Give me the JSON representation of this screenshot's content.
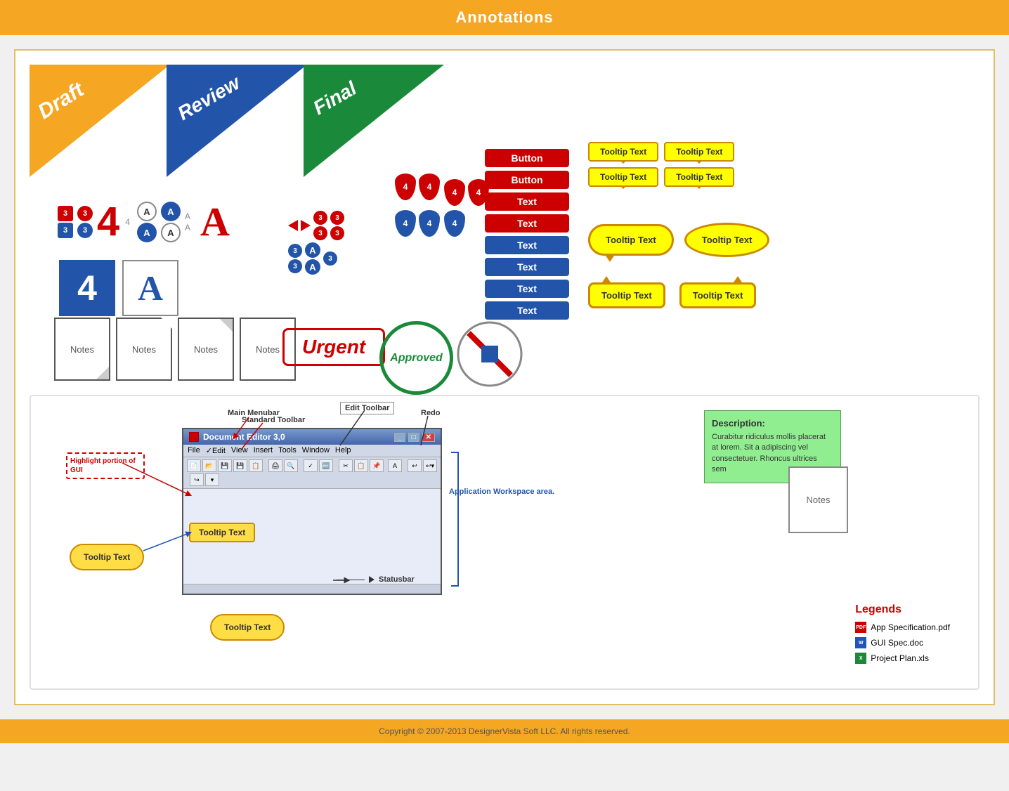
{
  "page": {
    "title": "Annotations",
    "footer": "Copyright © 2007-2013 DesignerVista Soft LLC. All rights reserved."
  },
  "banners": [
    {
      "label": "Draft",
      "color": "#F5A623"
    },
    {
      "label": "Review",
      "color": "#2255AA"
    },
    {
      "label": "Final",
      "color": "#1A8A3A"
    }
  ],
  "buttons": [
    {
      "label": "Button",
      "style": "red"
    },
    {
      "label": "Button",
      "style": "red"
    },
    {
      "label": "Text",
      "style": "red"
    },
    {
      "label": "Text",
      "style": "red"
    },
    {
      "label": "Text",
      "style": "blue"
    },
    {
      "label": "Text",
      "style": "blue"
    },
    {
      "label": "Text",
      "style": "blue"
    },
    {
      "label": "Text",
      "style": "blue"
    }
  ],
  "tooltips_top": [
    {
      "label": "Tooltip Text"
    },
    {
      "label": "Tooltip Text"
    },
    {
      "label": "Tooltip Text"
    },
    {
      "label": "Tooltip Text"
    }
  ],
  "tooltips_middle": [
    {
      "label": "Tooltip Text"
    },
    {
      "label": "Tooltip Text"
    }
  ],
  "tooltip_bottom": {
    "label": "Tooltip Text"
  },
  "stamps": {
    "urgent": "Urgent",
    "approved": "Approved",
    "prohibited": ""
  },
  "notes_labels": [
    "Notes",
    "Notes",
    "Notes",
    "Notes"
  ],
  "diagram": {
    "labels": {
      "main_menubar": "Main Menubar",
      "standard_toolbar": "Standard Toolbar",
      "edit_toolbar": "Edit Toolbar",
      "redo": "Redo",
      "statusbar": "Statusbar",
      "app_workspace": "Application Workspace area.",
      "highlight_label": "Highlight portion of GUI"
    },
    "editor": {
      "title": "Document Editor 3,0",
      "menu_items": [
        "File",
        "Edit",
        "View",
        "Insert",
        "Tools",
        "Window",
        "Help"
      ]
    },
    "tooltip_text": "Tooltip Text",
    "tooltip_text2": "Tooltip Text",
    "description": {
      "title": "Description:",
      "text": "Curabitur ridiculus mollis placerat at lorem. Sit a adipiscing vel consectetuer. Rhoncus ultrices sem"
    },
    "notes_label": "Notes",
    "legends": {
      "title": "Legends",
      "items": [
        {
          "icon": "pdf",
          "label": "App Specification.pdf"
        },
        {
          "icon": "doc",
          "label": "GUI Spec.doc"
        },
        {
          "icon": "xls",
          "label": "Project Plan.xls"
        }
      ]
    }
  }
}
